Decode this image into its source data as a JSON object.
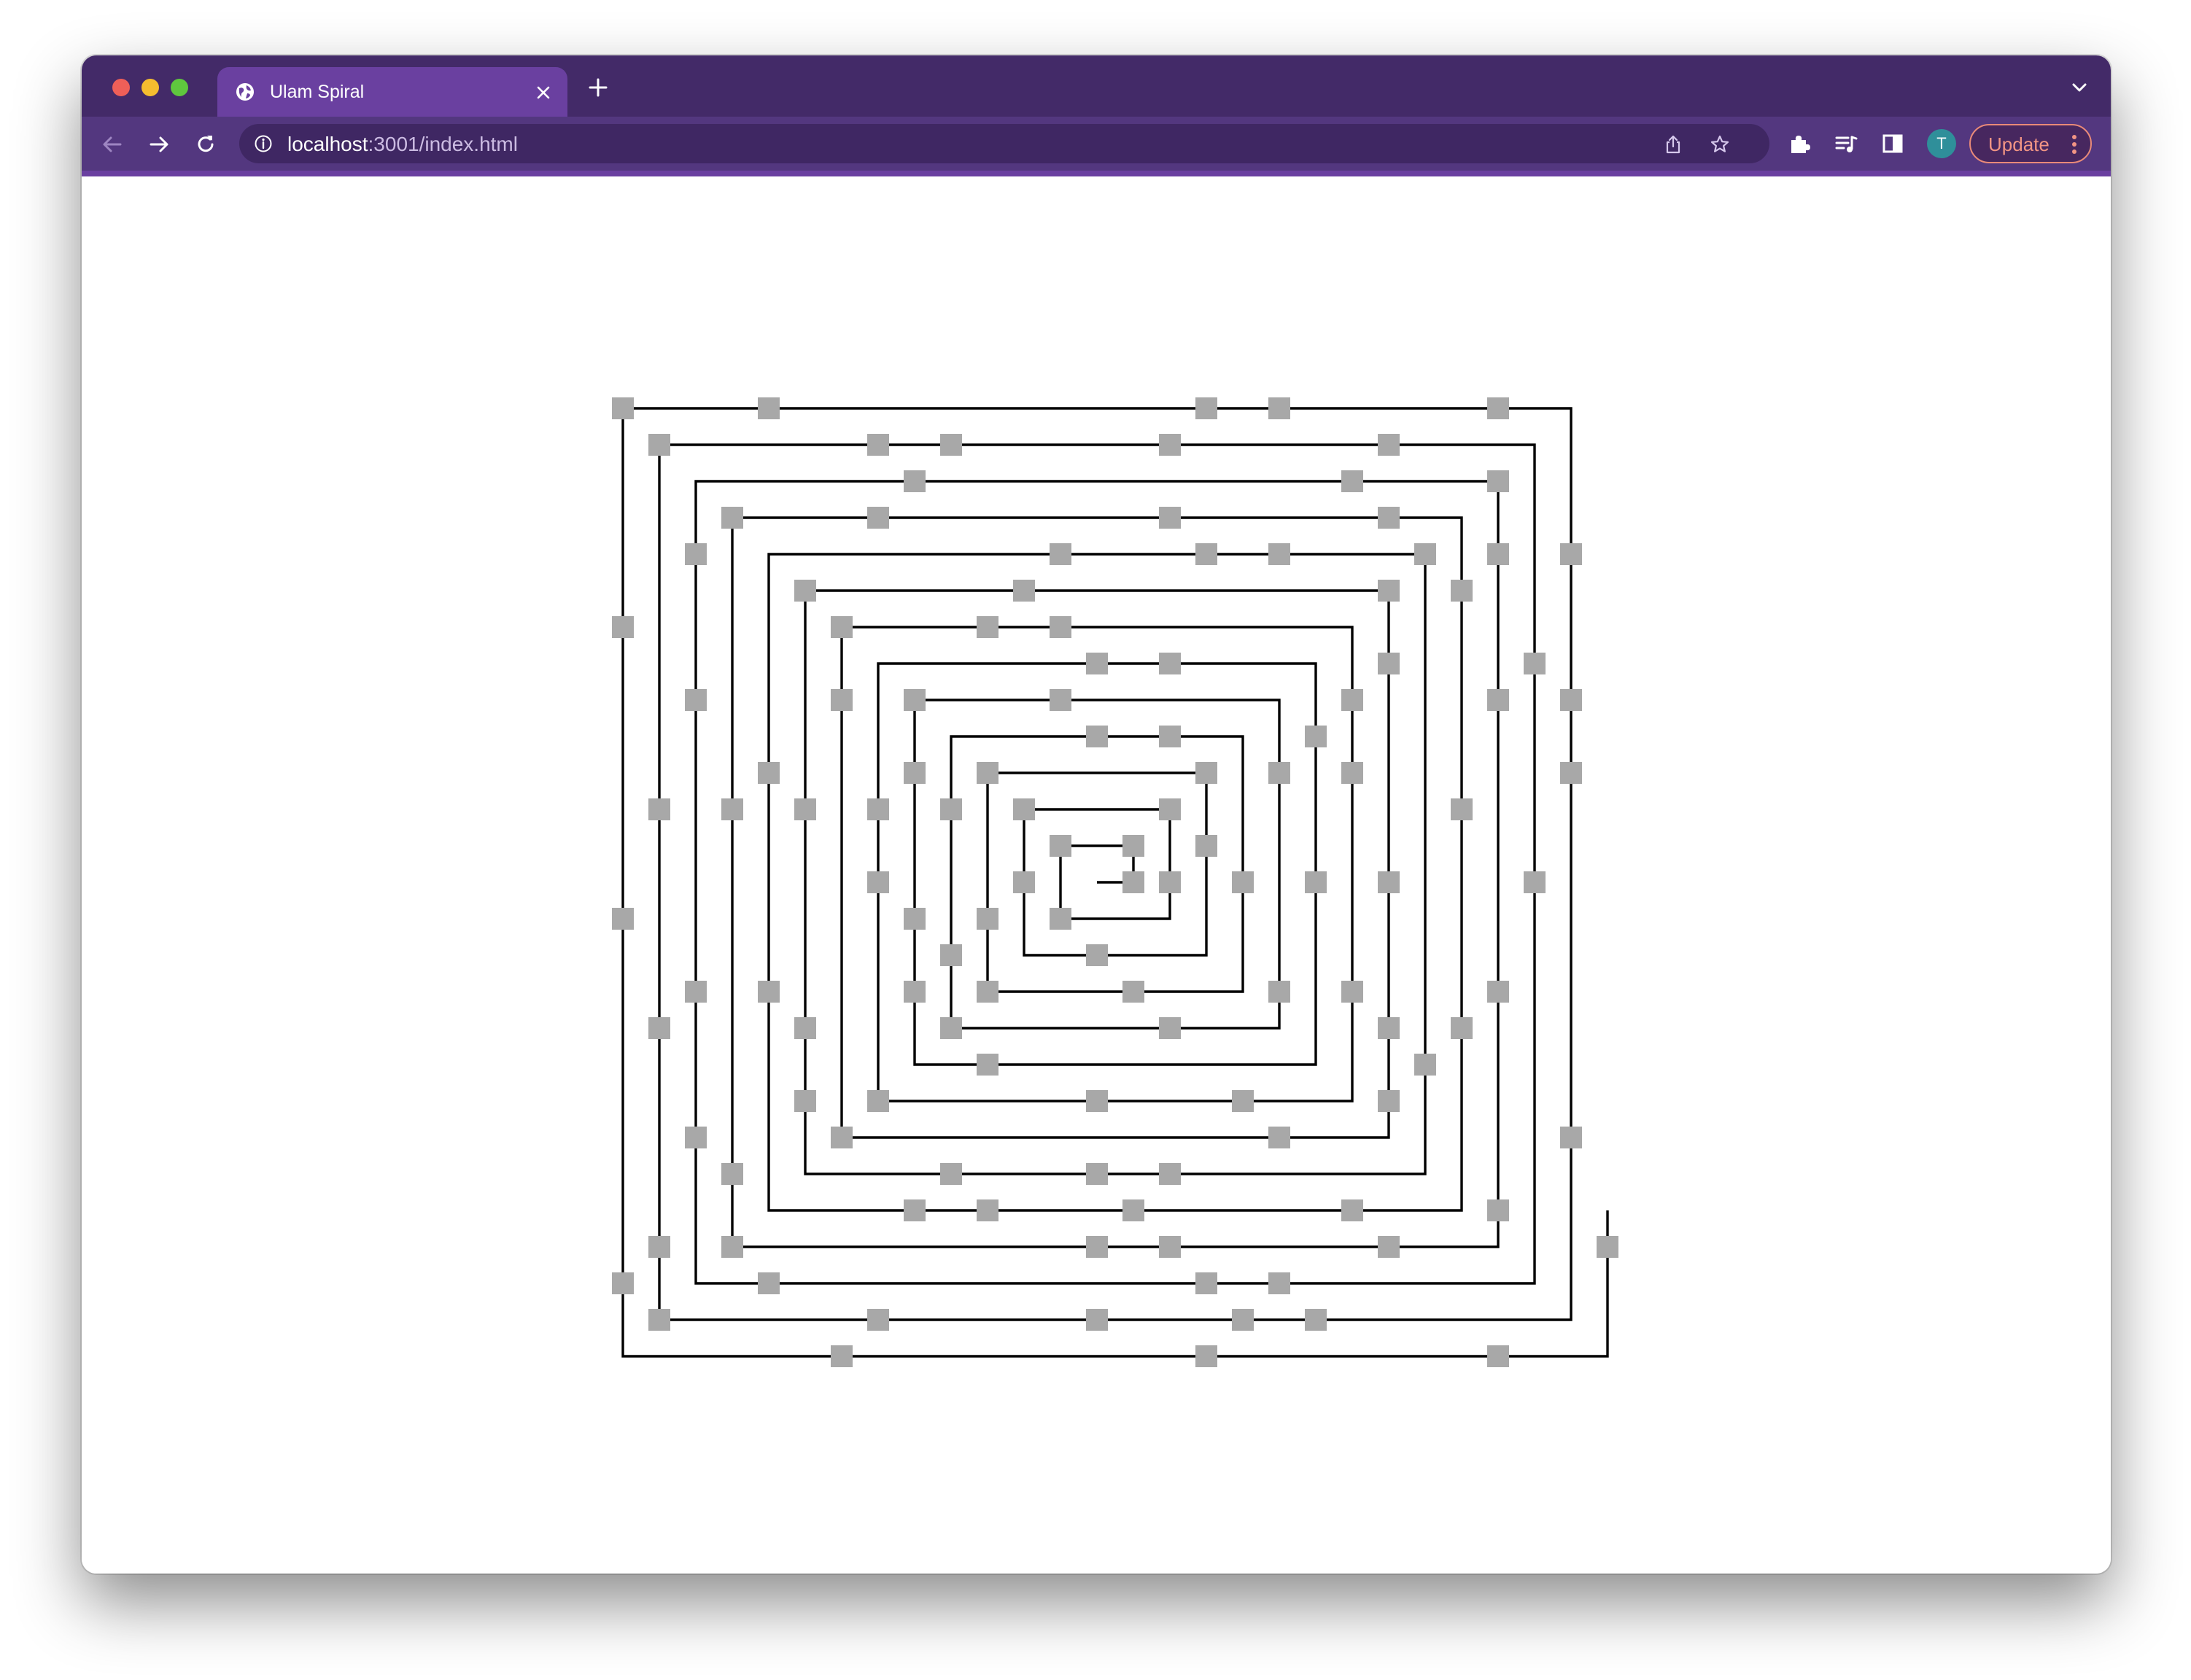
{
  "browser": {
    "tab_title": "Ulam Spiral",
    "url_host": "localhost",
    "url_path": ":3001/index.html",
    "avatar_initial": "T",
    "update_label": "Update"
  },
  "colors": {
    "tabbar": "#432a68",
    "toolbar": "#53377f",
    "active_tab": "#6a40a0",
    "prime_marker": "#a8a8a8",
    "spiral_line": "#000000"
  },
  "icons": [
    "globe-icon",
    "close-icon",
    "plus-icon",
    "chevron-down-icon",
    "back-arrow-icon",
    "forward-arrow-icon",
    "reload-icon",
    "info-icon",
    "share-icon",
    "star-icon",
    "puzzle-icon",
    "media-icon",
    "side-panel-icon",
    "kebab-menu-icon"
  ],
  "spiral": {
    "start": 1,
    "end": 734,
    "first_turn": "right",
    "marked": "prime numbers"
  }
}
